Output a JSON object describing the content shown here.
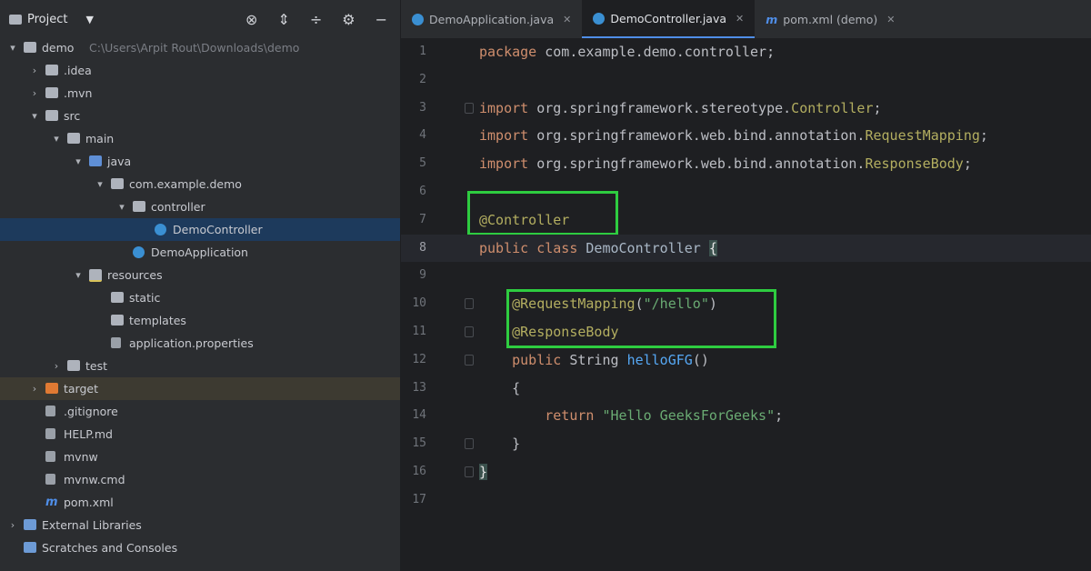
{
  "project_panel": {
    "title": "Project",
    "tree": [
      {
        "label": "demo",
        "suffix": "C:\\Users\\Arpit Rout\\Downloads\\demo",
        "depth": 0,
        "arrow": "▾",
        "icon": "folder"
      },
      {
        "label": ".idea",
        "depth": 1,
        "arrow": "›",
        "icon": "folder"
      },
      {
        "label": ".mvn",
        "depth": 1,
        "arrow": "›",
        "icon": "folder"
      },
      {
        "label": "src",
        "depth": 1,
        "arrow": "▾",
        "icon": "folder"
      },
      {
        "label": "main",
        "depth": 2,
        "arrow": "▾",
        "icon": "folder"
      },
      {
        "label": "java",
        "depth": 3,
        "arrow": "▾",
        "icon": "folder-blue"
      },
      {
        "label": "com.example.demo",
        "depth": 4,
        "arrow": "▾",
        "icon": "folder"
      },
      {
        "label": "controller",
        "depth": 5,
        "arrow": "▾",
        "icon": "folder"
      },
      {
        "label": "DemoController",
        "depth": 6,
        "arrow": "",
        "icon": "class",
        "selected": true
      },
      {
        "label": "DemoApplication",
        "depth": 5,
        "arrow": "",
        "icon": "class"
      },
      {
        "label": "resources",
        "depth": 3,
        "arrow": "▾",
        "icon": "folder-res"
      },
      {
        "label": "static",
        "depth": 4,
        "arrow": "",
        "icon": "folder"
      },
      {
        "label": "templates",
        "depth": 4,
        "arrow": "",
        "icon": "folder"
      },
      {
        "label": "application.properties",
        "depth": 4,
        "arrow": "",
        "icon": "file"
      },
      {
        "label": "test",
        "depth": 2,
        "arrow": "›",
        "icon": "folder"
      },
      {
        "label": "target",
        "depth": 1,
        "arrow": "›",
        "icon": "folder-orange",
        "excluded": true
      },
      {
        "label": ".gitignore",
        "depth": 1,
        "arrow": "",
        "icon": "file"
      },
      {
        "label": "HELP.md",
        "depth": 1,
        "arrow": "",
        "icon": "file"
      },
      {
        "label": "mvnw",
        "depth": 1,
        "arrow": "",
        "icon": "file"
      },
      {
        "label": "mvnw.cmd",
        "depth": 1,
        "arrow": "",
        "icon": "file"
      },
      {
        "label": "pom.xml",
        "depth": 1,
        "arrow": "",
        "icon": "maven"
      },
      {
        "label": "External Libraries",
        "depth": 0,
        "arrow": "›",
        "icon": "library"
      },
      {
        "label": "Scratches and Consoles",
        "depth": 0,
        "arrow": "",
        "icon": "scratch"
      }
    ]
  },
  "tabs": [
    {
      "label": "DemoApplication.java",
      "icon": "class-icon",
      "active": false
    },
    {
      "label": "DemoController.java",
      "icon": "class-icon",
      "active": true
    },
    {
      "label": "pom.xml (demo)",
      "icon": "maven-icon",
      "active": false
    }
  ],
  "code_lines": [
    {
      "n": "1",
      "tokens": [
        [
          "kw",
          "package"
        ],
        [
          "t",
          " com.example.demo.controller;"
        ]
      ]
    },
    {
      "n": "2",
      "tokens": []
    },
    {
      "n": "3",
      "tokens": [
        [
          "kw",
          "import"
        ],
        [
          "t",
          " org.springframework.stereotype."
        ],
        [
          "ann",
          "Controller"
        ],
        [
          "t",
          ";"
        ]
      ]
    },
    {
      "n": "4",
      "tokens": [
        [
          "kw",
          "import"
        ],
        [
          "t",
          " org.springframework.web.bind.annotation."
        ],
        [
          "ann",
          "RequestMapping"
        ],
        [
          "t",
          ";"
        ]
      ]
    },
    {
      "n": "5",
      "tokens": [
        [
          "kw",
          "import"
        ],
        [
          "t",
          " org.springframework.web.bind.annotation."
        ],
        [
          "ann",
          "ResponseBody"
        ],
        [
          "t",
          ";"
        ]
      ]
    },
    {
      "n": "6",
      "tokens": []
    },
    {
      "n": "7",
      "tokens": [
        [
          "ann",
          "@Controller"
        ]
      ]
    },
    {
      "n": "8",
      "tokens": [
        [
          "kw",
          "public class "
        ],
        [
          "cls",
          "DemoController "
        ],
        [
          "brace",
          "{"
        ]
      ],
      "current": true
    },
    {
      "n": "9",
      "tokens": []
    },
    {
      "n": "10",
      "tokens": [
        [
          "t",
          "    "
        ],
        [
          "ann",
          "@RequestMapping"
        ],
        [
          "t",
          "("
        ],
        [
          "str",
          "\"/hello\""
        ],
        [
          "t",
          ")"
        ]
      ]
    },
    {
      "n": "11",
      "tokens": [
        [
          "t",
          "    "
        ],
        [
          "ann",
          "@ResponseBody"
        ]
      ]
    },
    {
      "n": "12",
      "tokens": [
        [
          "t",
          "    "
        ],
        [
          "kw",
          "public "
        ],
        [
          "t",
          "String "
        ],
        [
          "fn",
          "helloGFG"
        ],
        [
          "t",
          "()"
        ]
      ]
    },
    {
      "n": "13",
      "tokens": [
        [
          "t",
          "    {"
        ]
      ]
    },
    {
      "n": "14",
      "tokens": [
        [
          "t",
          "        "
        ],
        [
          "kw",
          "return "
        ],
        [
          "str",
          "\"Hello GeeksForGeeks\""
        ],
        [
          "t",
          ";"
        ]
      ]
    },
    {
      "n": "15",
      "tokens": [
        [
          "t",
          "    }"
        ]
      ]
    },
    {
      "n": "16",
      "tokens": [
        [
          "brace",
          "}"
        ]
      ]
    },
    {
      "n": "17",
      "tokens": []
    }
  ],
  "colors": {
    "highlight_box": "#2ecc40",
    "keyword": "#cf8e6d",
    "annotation": "#b3ae60",
    "string": "#6aab73"
  }
}
